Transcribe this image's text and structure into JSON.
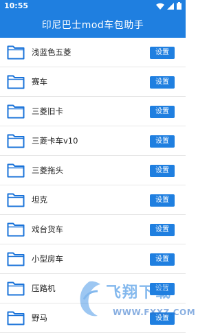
{
  "status": {
    "time": "10:55"
  },
  "app": {
    "title": "印尼巴士mod车包助手"
  },
  "items": [
    {
      "label": "浅蓝色五菱",
      "button": "设置"
    },
    {
      "label": "赛车",
      "button": "设置"
    },
    {
      "label": "三菱旧卡",
      "button": "设置"
    },
    {
      "label": "三菱卡车v10",
      "button": "设置"
    },
    {
      "label": "三菱拖头",
      "button": "设置"
    },
    {
      "label": "坦克",
      "button": "设置"
    },
    {
      "label": "戏台货车",
      "button": "设置"
    },
    {
      "label": "小型房车",
      "button": "设置"
    },
    {
      "label": "压路机",
      "button": "设置"
    },
    {
      "label": "野马",
      "button": "设置"
    }
  ],
  "watermark": {
    "text": "飞翔下载",
    "url": "WWW.FXXZ.COM"
  },
  "colors": {
    "accent": "#1f7fe0",
    "folder": "#1a73d9"
  }
}
